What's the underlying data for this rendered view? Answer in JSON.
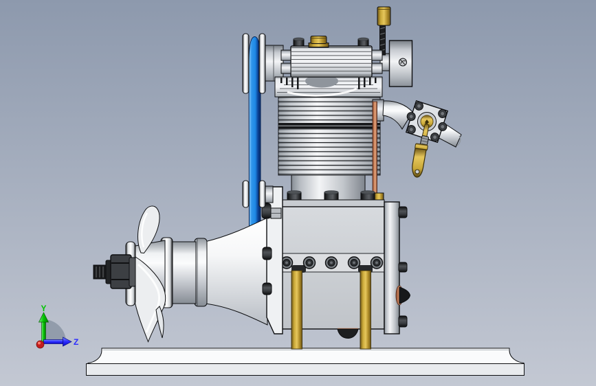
{
  "app": {
    "type": "3d-cad-viewport",
    "description": "Side view of a single-cylinder model engine with belt-driven overhead camshaft, carburetor and water impeller, mounted on a display base"
  },
  "triad": {
    "axis_up_label": "Y",
    "axis_right_label": "Z",
    "axis_up_color": "#00c400",
    "axis_right_color": "#2b2bff",
    "origin_color": "#c41e1e"
  },
  "colors": {
    "bg-top": "#8d99ad",
    "bg-bottom": "#c3c8d3",
    "belt-light": "#8ecbf8",
    "belt-mid": "#1e88e5",
    "belt-dark": "#0a3d8f",
    "brass": "#c9a838",
    "brass-light": "#e6c75c",
    "brass-dark": "#6e5617",
    "copper": "#d88f66",
    "metal-bright": "#f3f4f6",
    "metal-mid": "#c6cad0",
    "metal-dark": "#7f858d",
    "dark-part": "#2e3134",
    "base-white": "#fafbfc",
    "outline": "#0d0e10"
  },
  "parts": [
    {
      "name": "display-base",
      "color": "#fafbfc"
    },
    {
      "name": "mounting-standoffs",
      "color": "#c9a838"
    },
    {
      "name": "crankcase",
      "color": "#c6cad0"
    },
    {
      "name": "backplate",
      "color": "#c6cad0"
    },
    {
      "name": "cylinder-fins",
      "color": "#c6cad0"
    },
    {
      "name": "cylinder-head",
      "color": "#c6cad0"
    },
    {
      "name": "rocker-cover",
      "color": "#f3f4f6"
    },
    {
      "name": "oil-filler-cap",
      "color": "#c9a838"
    },
    {
      "name": "drive-belt",
      "color": "#1e88e5"
    },
    {
      "name": "upper-pulley",
      "color": "#f3f4f6"
    },
    {
      "name": "lower-pulley",
      "color": "#f3f4f6"
    },
    {
      "name": "camshaft-housing",
      "color": "#c6cad0"
    },
    {
      "name": "needle-valve-knob",
      "color": "#c9a838"
    },
    {
      "name": "carburetor",
      "color": "#dfe2e6"
    },
    {
      "name": "throttle-lever",
      "color": "#c9a838"
    },
    {
      "name": "intake-horn",
      "color": "#f3f4f6"
    },
    {
      "name": "pushrod-tube",
      "color": "#d88f66"
    },
    {
      "name": "impeller",
      "color": "#eceef0"
    },
    {
      "name": "propeller-nut",
      "color": "#2e3134"
    },
    {
      "name": "prop-shaft-cone",
      "color": "#fafbfc"
    }
  ]
}
